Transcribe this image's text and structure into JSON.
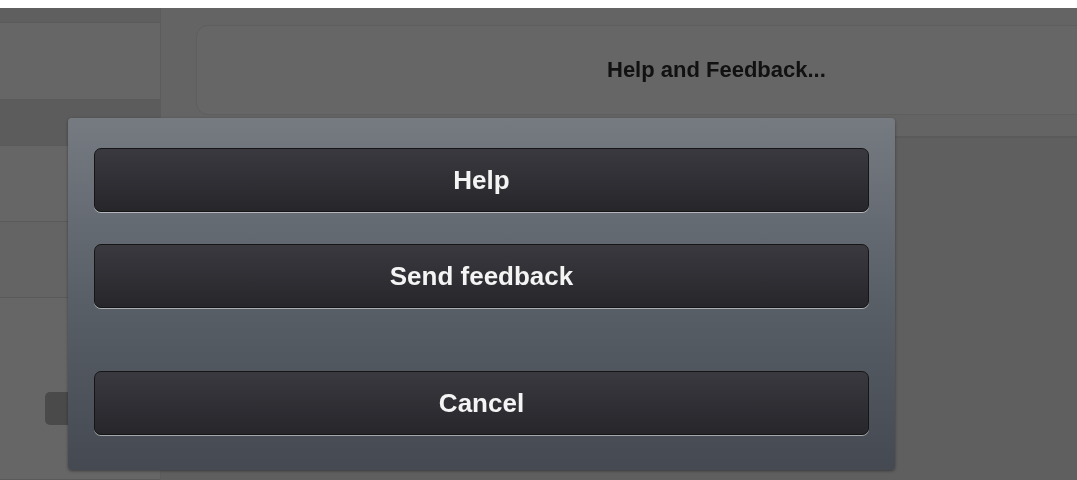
{
  "background": {
    "menu_row": "Help and Feedback..."
  },
  "action_sheet": {
    "buttons": [
      {
        "label": "Help",
        "kind": "action"
      },
      {
        "label": "Send feedback",
        "kind": "action"
      },
      {
        "label": "Cancel",
        "kind": "cancel"
      }
    ]
  }
}
